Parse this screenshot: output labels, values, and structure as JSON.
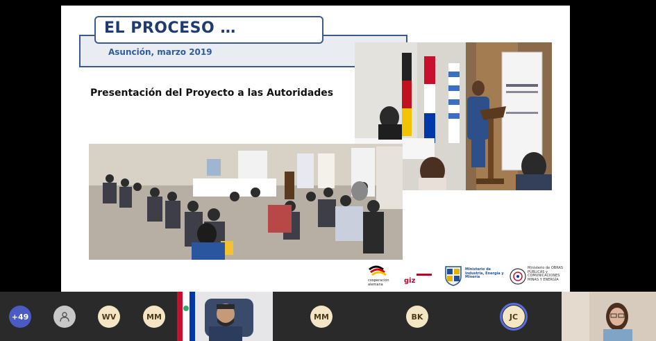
{
  "slide": {
    "title": "EL PROCESO …",
    "subtitle": "Asunción, marzo 2019",
    "heading": "Presentación del Proyecto a las Autoridades",
    "logos": [
      {
        "name": "cooperacion-alemana",
        "text": "cooperación alemana"
      },
      {
        "name": "giz",
        "text": "giz"
      },
      {
        "name": "ministerio-industria",
        "text": "Ministerio de Industria, Energía y Minería"
      },
      {
        "name": "ministerio-obras",
        "text": "Ministerio de OBRAS PÚBLICAS y COMUNICACIONES MINAS Y ENERGÍA"
      }
    ]
  },
  "participants": {
    "overflow_count": "+49",
    "tiles": [
      {
        "initials": "WV"
      },
      {
        "initials": "MM"
      },
      {
        "initials": "MM"
      },
      {
        "initials": "BK"
      },
      {
        "initials": "JC"
      }
    ]
  },
  "colors": {
    "title_border": "#3a5a8c",
    "title_text": "#1f3b70",
    "subtitle_text": "#2e5c9e",
    "avatar_bg": "#f4e6c4",
    "avatar_text": "#4a3a1a",
    "overflow_bg": "#4a5cc4",
    "active_ring": "#5b6ee0"
  }
}
